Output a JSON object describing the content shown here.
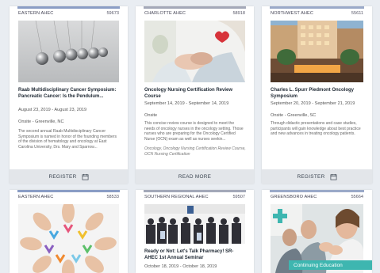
{
  "colors": {
    "bar_blue": "#8a9dc5",
    "bar_red": "#a3a8b8",
    "bar_teal": "#9aa9c8"
  },
  "cards": [
    {
      "region": "EASTERN AHEC",
      "code": "59673",
      "title": "Raab Multidisciplinary Cancer Symposium: Pancreatic Cancer: Is the Pendulum...",
      "dates": "August 23, 2019 - August 23, 2019",
      "location": "Onsite - Greenville, NC",
      "description": "The second annual Raab Multidisciplinary Cancer Symposium is named in honor of the founding members of the division of hematology and oncology at East Carolina University, Drs. Mary and Sparrow...",
      "action": "REGISTER",
      "image": "newtons-cradle-image"
    },
    {
      "region": "CHARLOTTE AHEC",
      "code": "58918",
      "title": "Oncology Nursing Certification Review Course",
      "dates": "September 14, 2019 - September 14, 2019",
      "location": "Onsite",
      "description": "This concise review course is designed to meet the needs of oncology nurses in the oncology setting. Those nurses who are preparing for the Oncology Certified Nurse (OCN) exam as well as nurses seekin...",
      "description2": "Oncology, Oncology Nursing Certification Review Course, OCN Nursing Certification",
      "action": "READ MORE",
      "image": "nurse-holding-hands-image"
    },
    {
      "region": "NORTHWEST AHEC",
      "code": "55611",
      "title": "Charles L. Spurr Piedmont Oncology Symposium",
      "dates": "September 20, 2019 - September 21, 2019",
      "location": "Onsite - Greenville, SC",
      "description": "Through didactic presentations and case studies, participants will gain knowledge about best practice and new advances in treating oncology patients.",
      "action": "REGISTER",
      "image": "hotel-courtyard-image"
    },
    {
      "region": "EASTERN AHEC",
      "code": "58533",
      "image": "hands-ribbons-image"
    },
    {
      "region": "SOUTHERN REGIONAL AHEC",
      "code": "59507",
      "title": "Ready or Not: Let's Talk Pharmacy! SR-AHEC 1st Annual Seminar",
      "dates": "October 18, 2019 - October 18, 2019",
      "image": "seminar-audience-image"
    },
    {
      "region": "GREENSBORO AHEC",
      "code": "55664",
      "banner": "Continuing Education",
      "image": "applauding-audience-image"
    }
  ]
}
